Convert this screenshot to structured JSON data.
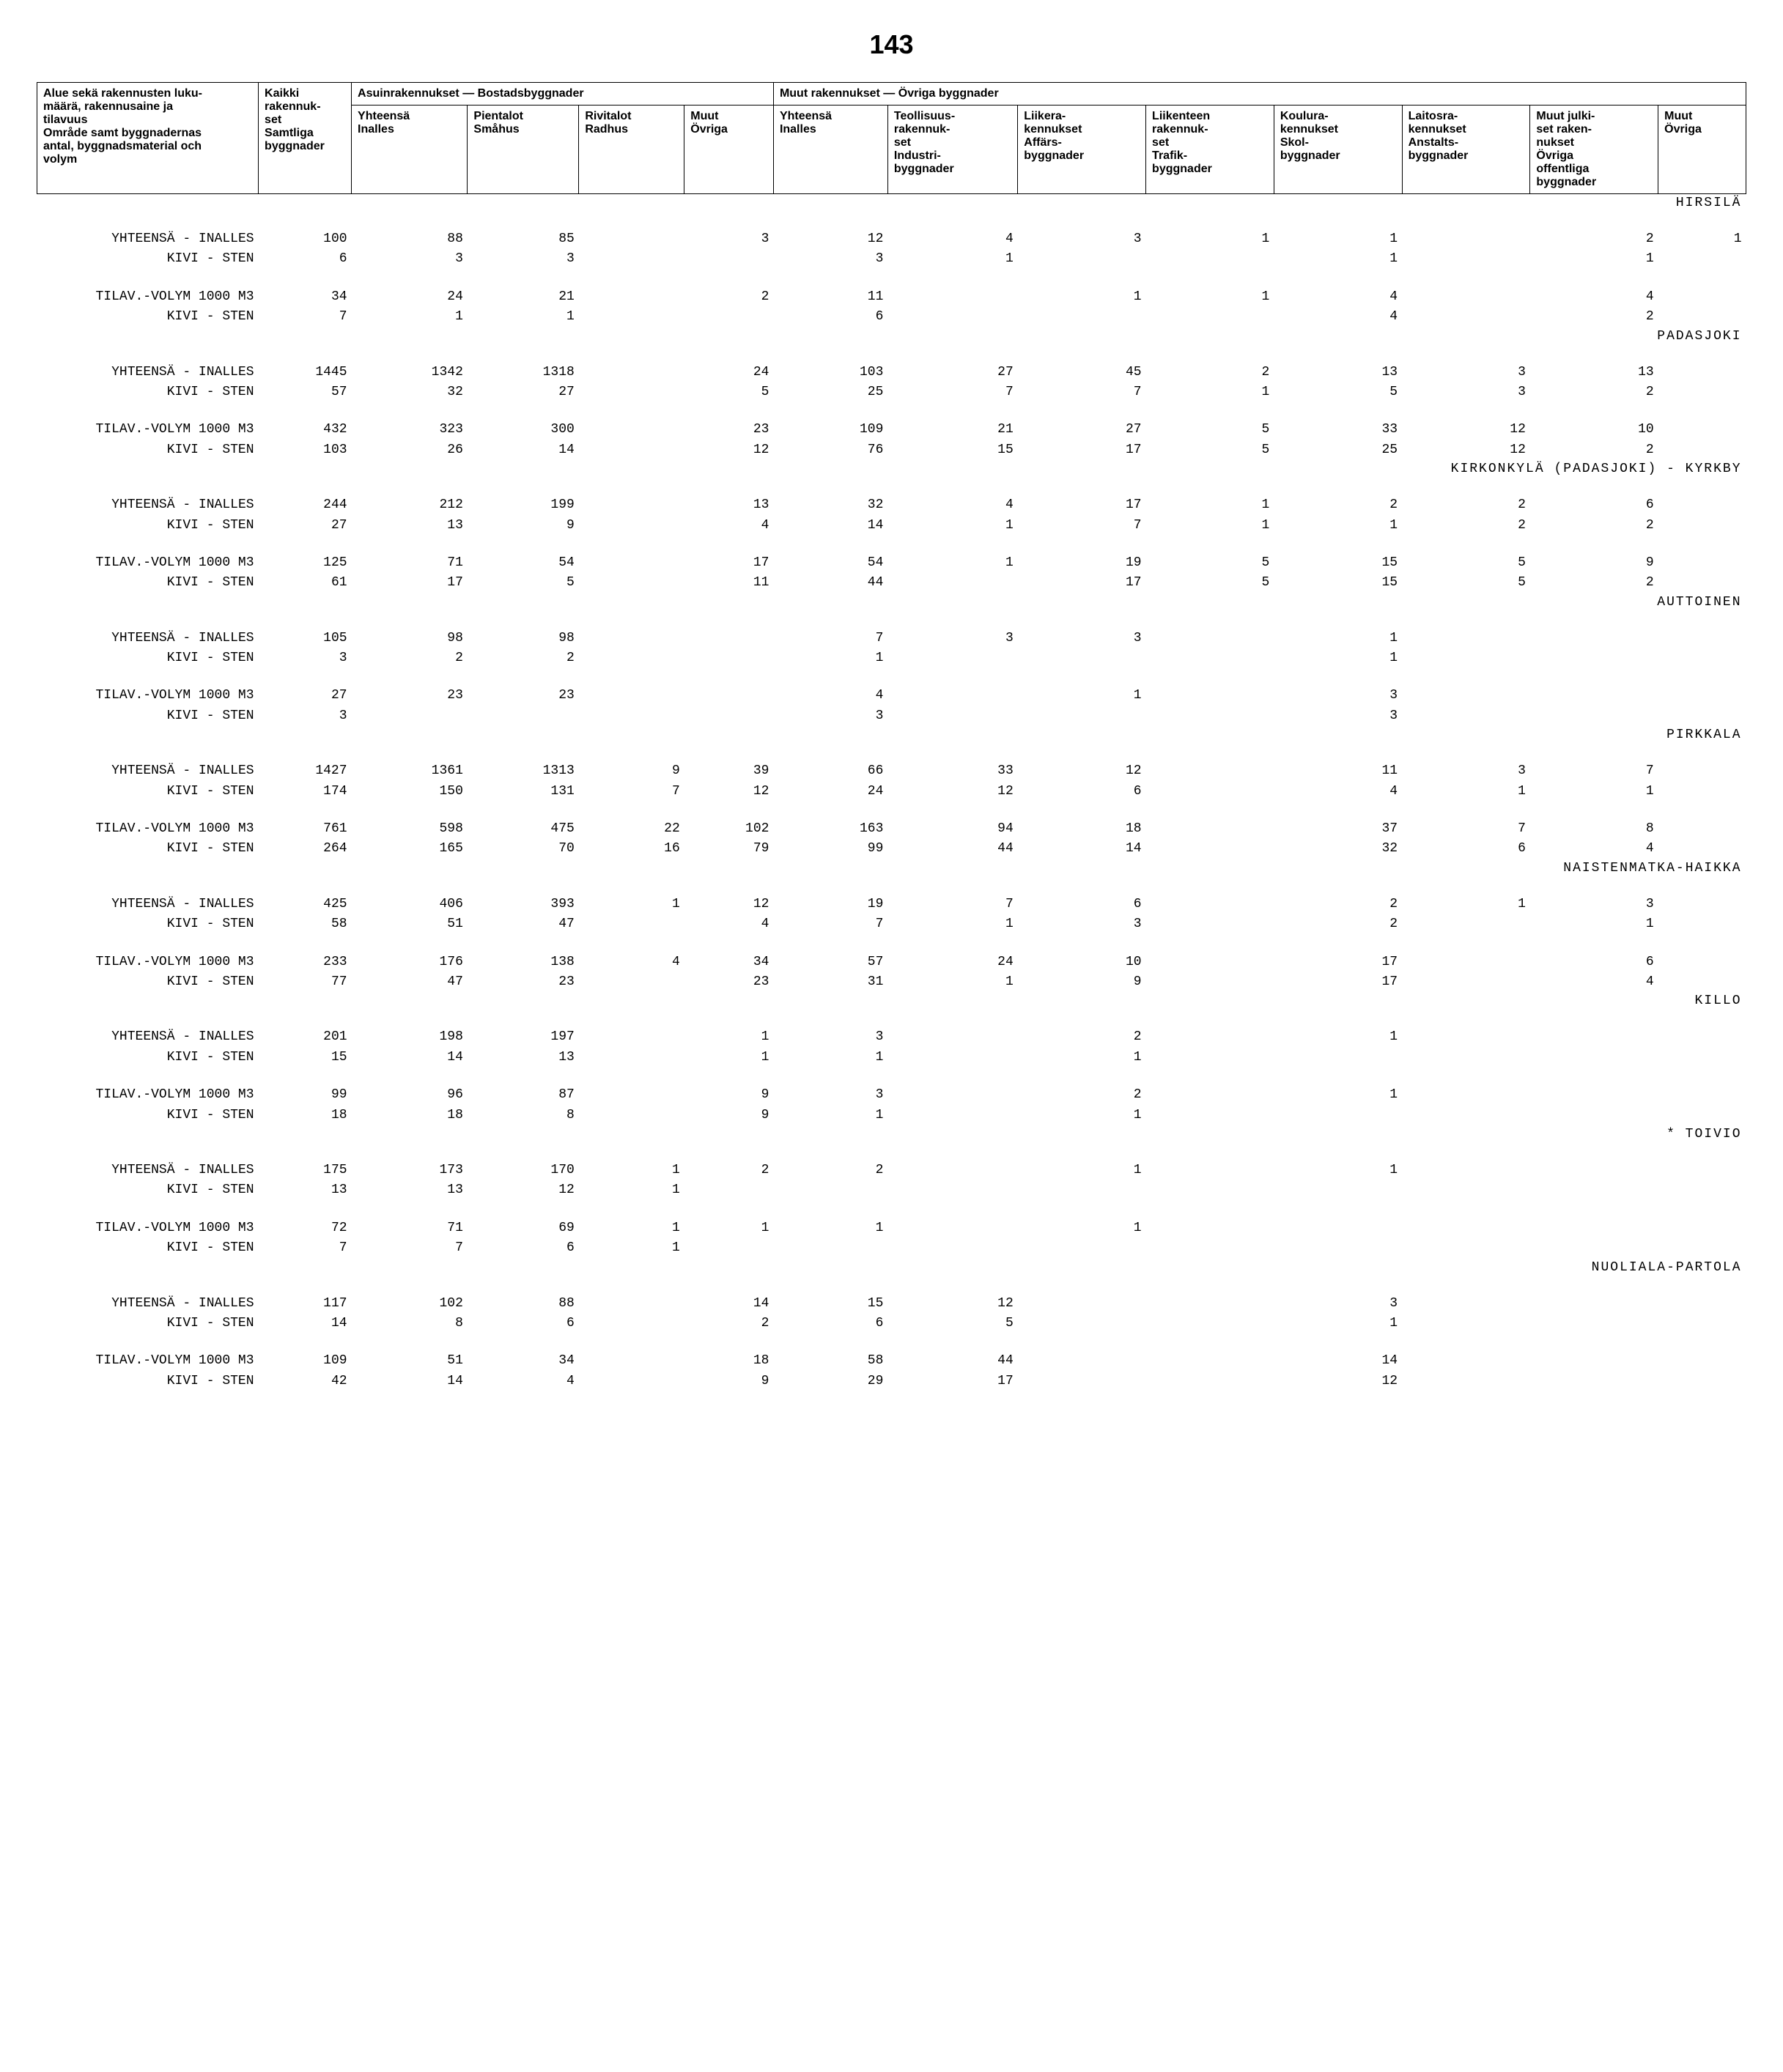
{
  "page_number": "143",
  "header": {
    "col0": "Alue sekä rakennusten luku-\nmäärä, rakennusaine ja\ntilavuus\nOmråde samt byggnadernas\nantal, byggnadsmaterial och\nvolym",
    "col1": "Kaikki\nrakennuk-\nset\nSamtliga\nbyggnader",
    "group_res": "Asuinrakennukset — Bostadsbyggnader",
    "col2": "Yhteensä\nInalles",
    "col3": "Pientalot\nSmåhus",
    "col4": "Rivitalot\nRadhus",
    "col5": "Muut\nÖvriga",
    "group_other": "Muut rakennukset — Övriga byggnader",
    "col6": "Yhteensä\nInalles",
    "col7": "Teollisuus-\nrakennuk-\nset\nIndustri-\nbyggnader",
    "col8": "Liikera-\nkennukset\nAffärs-\nbyggnader",
    "col9": "Liikenteen\nrakennuk-\nset\nTrafik-\nbyggnader",
    "col10": "Koulura-\nkennukset\nSkol-\nbyggnader",
    "col11": "Laitosra-\nkennukset\nAnstalts-\nbyggnader",
    "col12": "Muut julki-\nset raken-\nnukset\nÖvriga\noffentliga\nbyggnader",
    "col13": "Muut\nÖvriga"
  },
  "labels": {
    "yht": "YHTEENSÄ - INALLES",
    "kivi": "KIVI - STEN",
    "tilav": "TILAV.-VOLYM 1000 M3"
  },
  "sections": [
    {
      "name": "HIRSILÄ",
      "indent": 1,
      "rows": [
        {
          "t": "yht",
          "v": [
            "100",
            "88",
            "85",
            "",
            "3",
            "12",
            "4",
            "3",
            "1",
            "1",
            "",
            "2",
            "1"
          ]
        },
        {
          "t": "kivi",
          "v": [
            "6",
            "3",
            "3",
            "",
            "",
            "3",
            "1",
            "",
            "",
            "1",
            "",
            "1",
            ""
          ]
        },
        {
          "t": "tilav",
          "v": [
            "34",
            "24",
            "21",
            "",
            "2",
            "11",
            "",
            "1",
            "1",
            "4",
            "",
            "4",
            ""
          ]
        },
        {
          "t": "kivi",
          "v": [
            "7",
            "1",
            "1",
            "",
            "",
            "6",
            "",
            "",
            "",
            "4",
            "",
            "2",
            ""
          ]
        }
      ]
    },
    {
      "name": "PADASJOKI",
      "indent": 0,
      "rows": [
        {
          "t": "yht",
          "v": [
            "1445",
            "1342",
            "1318",
            "",
            "24",
            "103",
            "27",
            "45",
            "2",
            "13",
            "3",
            "13",
            ""
          ]
        },
        {
          "t": "kivi",
          "v": [
            "57",
            "32",
            "27",
            "",
            "5",
            "25",
            "7",
            "7",
            "1",
            "5",
            "3",
            "2",
            ""
          ]
        },
        {
          "t": "tilav",
          "v": [
            "432",
            "323",
            "300",
            "",
            "23",
            "109",
            "21",
            "27",
            "5",
            "33",
            "12",
            "10",
            ""
          ]
        },
        {
          "t": "kivi",
          "v": [
            "103",
            "26",
            "14",
            "",
            "12",
            "76",
            "15",
            "17",
            "5",
            "25",
            "12",
            "2",
            ""
          ]
        }
      ]
    },
    {
      "name": "KIRKONKYLÄ (PADASJOKI) - KYRKBY",
      "indent": 1,
      "rows": [
        {
          "t": "yht",
          "v": [
            "244",
            "212",
            "199",
            "",
            "13",
            "32",
            "4",
            "17",
            "1",
            "2",
            "2",
            "6",
            ""
          ]
        },
        {
          "t": "kivi",
          "v": [
            "27",
            "13",
            "9",
            "",
            "4",
            "14",
            "1",
            "7",
            "1",
            "1",
            "2",
            "2",
            ""
          ]
        },
        {
          "t": "tilav",
          "v": [
            "125",
            "71",
            "54",
            "",
            "17",
            "54",
            "1",
            "19",
            "5",
            "15",
            "5",
            "9",
            ""
          ]
        },
        {
          "t": "kivi",
          "v": [
            "61",
            "17",
            "5",
            "",
            "11",
            "44",
            "",
            "17",
            "5",
            "15",
            "5",
            "2",
            ""
          ]
        }
      ]
    },
    {
      "name": "AUTTOINEN",
      "indent": 1,
      "rows": [
        {
          "t": "yht",
          "v": [
            "105",
            "98",
            "98",
            "",
            "",
            "7",
            "3",
            "3",
            "",
            "1",
            "",
            "",
            ""
          ]
        },
        {
          "t": "kivi",
          "v": [
            "3",
            "2",
            "2",
            "",
            "",
            "1",
            "",
            "",
            "",
            "1",
            "",
            "",
            ""
          ]
        },
        {
          "t": "tilav",
          "v": [
            "27",
            "23",
            "23",
            "",
            "",
            "4",
            "",
            "1",
            "",
            "3",
            "",
            "",
            ""
          ]
        },
        {
          "t": "kivi",
          "v": [
            "3",
            "",
            "",
            "",
            "",
            "3",
            "",
            "",
            "",
            "3",
            "",
            "",
            ""
          ]
        }
      ]
    },
    {
      "name": "PIRKKALA",
      "indent": 0,
      "rows": [
        {
          "t": "yht",
          "v": [
            "1427",
            "1361",
            "1313",
            "9",
            "39",
            "66",
            "33",
            "12",
            "",
            "11",
            "3",
            "7",
            ""
          ]
        },
        {
          "t": "kivi",
          "v": [
            "174",
            "150",
            "131",
            "7",
            "12",
            "24",
            "12",
            "6",
            "",
            "4",
            "1",
            "1",
            ""
          ]
        },
        {
          "t": "tilav",
          "v": [
            "761",
            "598",
            "475",
            "22",
            "102",
            "163",
            "94",
            "18",
            "",
            "37",
            "7",
            "8",
            ""
          ]
        },
        {
          "t": "kivi",
          "v": [
            "264",
            "165",
            "70",
            "16",
            "79",
            "99",
            "44",
            "14",
            "",
            "32",
            "6",
            "4",
            ""
          ]
        }
      ]
    },
    {
      "name": "NAISTENMATKA-HAIKKA",
      "indent": 1,
      "rows": [
        {
          "t": "yht",
          "v": [
            "425",
            "406",
            "393",
            "1",
            "12",
            "19",
            "7",
            "6",
            "",
            "2",
            "1",
            "3",
            ""
          ]
        },
        {
          "t": "kivi",
          "v": [
            "58",
            "51",
            "47",
            "",
            "4",
            "7",
            "1",
            "3",
            "",
            "2",
            "",
            "1",
            ""
          ]
        },
        {
          "t": "tilav",
          "v": [
            "233",
            "176",
            "138",
            "4",
            "34",
            "57",
            "24",
            "10",
            "",
            "17",
            "",
            "6",
            ""
          ]
        },
        {
          "t": "kivi",
          "v": [
            "77",
            "47",
            "23",
            "",
            "23",
            "31",
            "1",
            "9",
            "",
            "17",
            "",
            "4",
            ""
          ]
        }
      ]
    },
    {
      "name": "KILLO",
      "indent": 1,
      "rows": [
        {
          "t": "yht",
          "v": [
            "201",
            "198",
            "197",
            "",
            "1",
            "3",
            "",
            "2",
            "",
            "1",
            "",
            "",
            ""
          ]
        },
        {
          "t": "kivi",
          "v": [
            "15",
            "14",
            "13",
            "",
            "1",
            "1",
            "",
            "1",
            "",
            "",
            "",
            "",
            ""
          ]
        },
        {
          "t": "tilav",
          "v": [
            "99",
            "96",
            "87",
            "",
            "9",
            "3",
            "",
            "2",
            "",
            "1",
            "",
            "",
            ""
          ]
        },
        {
          "t": "kivi",
          "v": [
            "18",
            "18",
            "8",
            "",
            "9",
            "1",
            "",
            "1",
            "",
            "",
            "",
            "",
            ""
          ]
        }
      ]
    },
    {
      "name": "* TOIVIO",
      "indent": 0,
      "rows": [
        {
          "t": "yht",
          "v": [
            "175",
            "173",
            "170",
            "1",
            "2",
            "2",
            "",
            "1",
            "",
            "1",
            "",
            "",
            ""
          ]
        },
        {
          "t": "kivi",
          "v": [
            "13",
            "13",
            "12",
            "1",
            "",
            "",
            "",
            "",
            "",
            "",
            "",
            "",
            ""
          ]
        },
        {
          "t": "tilav",
          "v": [
            "72",
            "71",
            "69",
            "1",
            "1",
            "1",
            "",
            "1",
            "",
            "",
            "",
            "",
            ""
          ]
        },
        {
          "t": "kivi",
          "v": [
            "7",
            "7",
            "6",
            "1",
            "",
            "",
            "",
            "",
            "",
            "",
            "",
            "",
            ""
          ]
        }
      ]
    },
    {
      "name": "NUOLIALA-PARTOLA",
      "indent": 1,
      "rows": [
        {
          "t": "yht",
          "v": [
            "117",
            "102",
            "88",
            "",
            "14",
            "15",
            "12",
            "",
            "",
            "3",
            "",
            "",
            ""
          ]
        },
        {
          "t": "kivi",
          "v": [
            "14",
            "8",
            "6",
            "",
            "2",
            "6",
            "5",
            "",
            "",
            "1",
            "",
            "",
            ""
          ]
        },
        {
          "t": "tilav",
          "v": [
            "109",
            "51",
            "34",
            "",
            "18",
            "58",
            "44",
            "",
            "",
            "14",
            "",
            "",
            ""
          ]
        },
        {
          "t": "kivi",
          "v": [
            "42",
            "14",
            "4",
            "",
            "9",
            "29",
            "17",
            "",
            "",
            "12",
            "",
            "",
            ""
          ]
        }
      ]
    }
  ]
}
